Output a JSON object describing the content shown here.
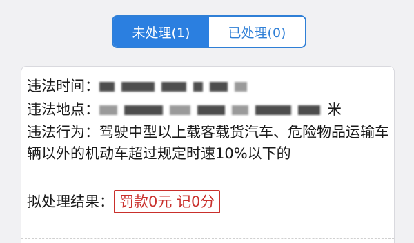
{
  "tabs": [
    {
      "label": "未处理(1)",
      "active": true
    },
    {
      "label": "已处理(0)",
      "active": false
    }
  ],
  "record": {
    "time_label": "违法时间：",
    "location_label": "违法地点：",
    "location_suffix": "米",
    "behavior_label": "违法行为：",
    "behavior_text": "驾驶中型以上载客载货汽车、危险物品运输车辆以外的机动车超过规定时速10%以下的",
    "result_label": "拟处理结果：",
    "result_value": "罚款0元  记0分"
  },
  "colors": {
    "accent": "#2b7fe0",
    "result_red": "#c9302c"
  }
}
